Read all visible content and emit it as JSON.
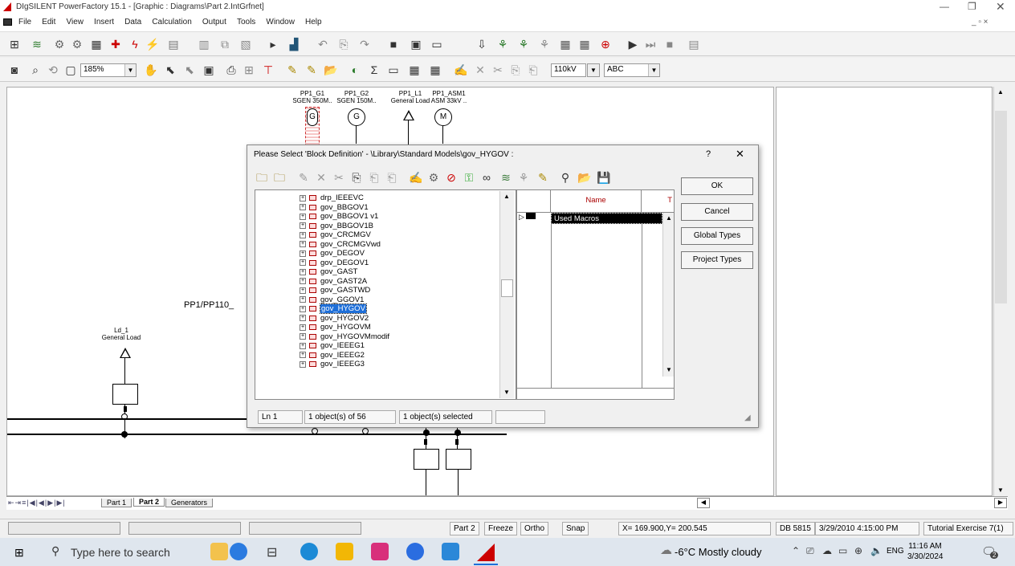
{
  "window": {
    "title": "DIgSILENT PowerFactory 15.1 - [Graphic : Diagrams\\Part 2.IntGrfnet]"
  },
  "menu": [
    "File",
    "Edit",
    "View",
    "Insert",
    "Data",
    "Calculation",
    "Output",
    "Tools",
    "Window",
    "Help"
  ],
  "toolbar2": {
    "zoom": "185%",
    "voltage": "110kV",
    "text_style": "ABC"
  },
  "diagram": {
    "gen1_name": "PP1_G1",
    "gen1_type": "SGEN 350M..",
    "gen2_name": "PP1_G2",
    "gen2_type": "SGEN 150M..",
    "load_name": "PP1_L1",
    "load_type": "General Load",
    "motor_name": "PP1_ASM1",
    "motor_type": "ASM 33kV ..",
    "gen_symbol": "G",
    "motor_symbol": "M",
    "busbar_label": "PP1/PP110_",
    "ld1_name": "Ld_1",
    "ld1_type": "General Load"
  },
  "dialog": {
    "title": "Please Select 'Block Definition' - \\Library\\Standard Models\\gov_HYGOV :",
    "help": "?",
    "close": "✕",
    "tree_items": [
      "drp_IEEEVC",
      "gov_BBGOV1",
      "gov_BBGOV1 v1",
      "gov_BBGOV1B",
      "gov_CRCMGV",
      "gov_CRCMGVwd",
      "gov_DEGOV",
      "gov_DEGOV1",
      "gov_GAST",
      "gov_GAST2A",
      "gov_GASTWD",
      "gov_GGOV1",
      "gov_HYGOV",
      "gov_HYGOV2",
      "gov_HYGOVM",
      "gov_HYGOVMmodif",
      "gov_IEEEG1",
      "gov_IEEEG2",
      "gov_IEEEG3"
    ],
    "selected_item": "gov_HYGOV",
    "list_header_name": "Name",
    "list_header_type": "T",
    "list_row": "Used Macros",
    "buttons": {
      "ok": "OK",
      "cancel": "Cancel",
      "global": "Global Types",
      "project": "Project Types"
    },
    "status": {
      "line": "Ln 1",
      "count": "1 object(s) of 56",
      "selected": "1 object(s) selected"
    }
  },
  "tabs": [
    "Part 1",
    "Part 2",
    "Generators"
  ],
  "statusbar": {
    "page": "Part 2",
    "freeze": "Freeze",
    "ortho": "Ortho",
    "snap": "Snap",
    "coords": "X=  169.900,Y=  200.545",
    "db": "DB 5815",
    "date": "3/29/2010 4:15:00 PM",
    "project": "Tutorial Exercise 7(1)"
  },
  "taskbar": {
    "search_placeholder": "Type here to search",
    "weather": "-6°C  Mostly cloudy",
    "lang": "ENG",
    "time": "11:16 AM",
    "date": "3/30/2024",
    "notif_count": "2"
  },
  "colors": {
    "accent": "#1e6fd9",
    "taskbar": "#dfe6ee",
    "selection": "#000000"
  }
}
